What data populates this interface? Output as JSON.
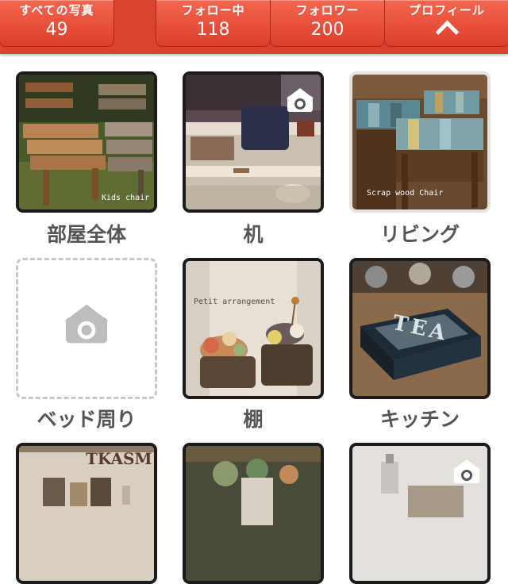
{
  "header": {
    "stats": [
      {
        "label": "すべての写真",
        "value": "49"
      },
      {
        "label": "フォロー中",
        "value": "118"
      },
      {
        "label": "フォロワー",
        "value": "200"
      }
    ],
    "profile": {
      "label": "プロフィール",
      "icon": "chevron-up-icon"
    }
  },
  "albums": [
    {
      "label": "部屋全体",
      "caption": "Kids chair"
    },
    {
      "label": "机",
      "icon": "camera-house-icon"
    },
    {
      "label": "リビング",
      "caption": "Scrap wood Chair"
    },
    {
      "label": "ベッド周り",
      "icon": "camera-house-icon"
    },
    {
      "label": "棚",
      "caption": "Petit arrangement"
    },
    {
      "label": "キッチン",
      "photo_text": "TEA"
    },
    {
      "photo_text": "TKASM"
    },
    {},
    {
      "icon": "camera-house-icon"
    }
  ],
  "colors": {
    "header": "#d9432f",
    "button_border": "#a7281a",
    "label_text": "#555555"
  }
}
